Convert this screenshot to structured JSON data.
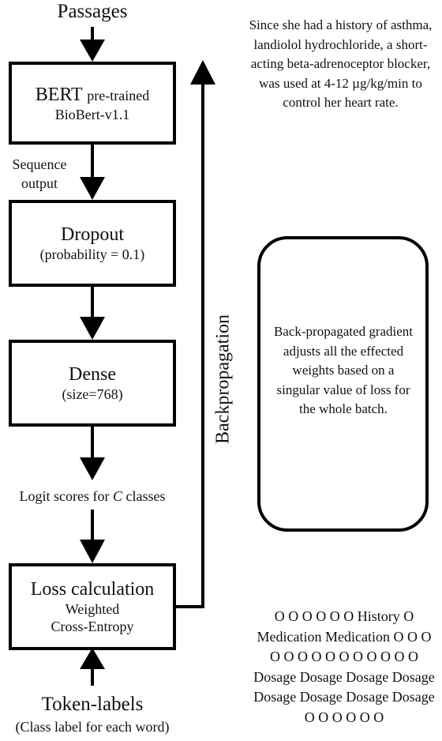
{
  "input_label": "Passages",
  "bert": {
    "title": "BERT",
    "title_suffix": "pre-trained",
    "subtitle": "BioBert-v1.1"
  },
  "sequence_output_label": [
    "Sequence",
    "output"
  ],
  "dropout": {
    "title": "Dropout",
    "subtitle": "(probability = 0.1)"
  },
  "dense": {
    "title": "Dense",
    "subtitle": "(size=768)"
  },
  "logit_label": {
    "prefix": "Logit scores for ",
    "var": "C",
    "suffix": " classes"
  },
  "loss": {
    "title": "Loss calculation",
    "line1": "Weighted",
    "line2": "Cross-Entropy"
  },
  "token_labels": {
    "title": "Token-labels",
    "subtitle": "(Class label for each word)"
  },
  "backprop_label": "Backpropagation",
  "example_passage": "Since she had a history of asthma, landiolol hydrochloride, a short-acting beta-adrenoceptor blocker, was used at 4-12 µg/kg/min to control her heart rate.",
  "backprop_note": "Back-propagated gradient adjusts all the effected weights based on a singular value of loss for the whole batch.",
  "example_labels": "O O O O O O History O Medication Medication O O O O O O O O O O O O O O Dosage Dosage Dosage Dosage Dosage Dosage Dosage Dosage O O O O O O"
}
